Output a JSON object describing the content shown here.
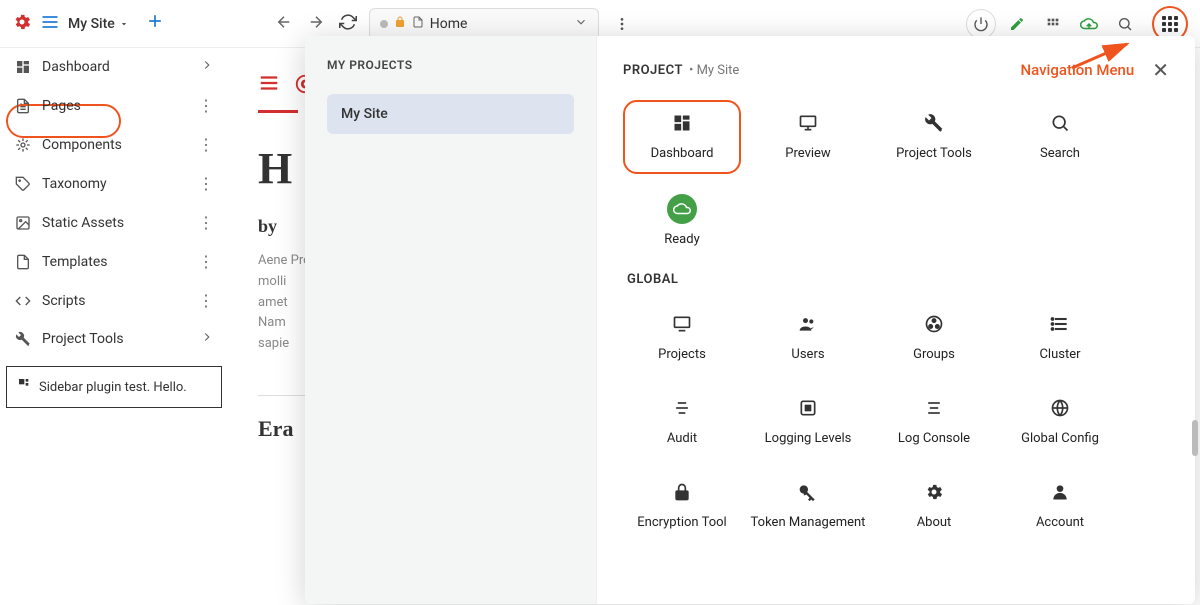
{
  "topbar": {
    "site_name": "My Site",
    "address": {
      "title": "Home"
    }
  },
  "sidebar": {
    "items": [
      {
        "label": "Dashboard",
        "icon": "dashboard",
        "chev": true
      },
      {
        "label": "Pages",
        "icon": "page",
        "more": true
      },
      {
        "label": "Components",
        "icon": "component",
        "more": true
      },
      {
        "label": "Taxonomy",
        "icon": "tag",
        "more": true
      },
      {
        "label": "Static Assets",
        "icon": "image",
        "more": true
      },
      {
        "label": "Templates",
        "icon": "file",
        "more": true
      },
      {
        "label": "Scripts",
        "icon": "code",
        "more": true
      },
      {
        "label": "Project Tools",
        "icon": "wrench",
        "chev": true
      }
    ],
    "plugin_text": "Sidebar plugin test. Hello."
  },
  "content": {
    "heading_partial": "H",
    "byline": "by",
    "body": "Aene Proi molli amet Nam sapie",
    "subheading": "Era"
  },
  "overlay": {
    "my_projects_label": "MY PROJECTS",
    "project_item": "My Site",
    "project_heading": "PROJECT",
    "project_sub": "• My Site",
    "nav_menu_label": "Navigation Menu",
    "project_tiles": [
      {
        "label": "Dashboard",
        "icon": "dashboard"
      },
      {
        "label": "Preview",
        "icon": "preview"
      },
      {
        "label": "Project Tools",
        "icon": "wrench"
      },
      {
        "label": "Search",
        "icon": "search"
      }
    ],
    "status_tile": {
      "label": "Ready",
      "icon": "cloud"
    },
    "global_label": "GLOBAL",
    "global_tiles": [
      {
        "label": "Projects",
        "icon": "projects"
      },
      {
        "label": "Users",
        "icon": "users"
      },
      {
        "label": "Groups",
        "icon": "globe"
      },
      {
        "label": "Cluster",
        "icon": "list"
      },
      {
        "label": "Audit",
        "icon": "lines"
      },
      {
        "label": "Logging Levels",
        "icon": "levels"
      },
      {
        "label": "Log Console",
        "icon": "console"
      },
      {
        "label": "Global Config",
        "icon": "world"
      },
      {
        "label": "Encryption Tool",
        "icon": "lock"
      },
      {
        "label": "Token Management",
        "icon": "key"
      },
      {
        "label": "About",
        "icon": "gear"
      },
      {
        "label": "Account",
        "icon": "account"
      }
    ]
  }
}
